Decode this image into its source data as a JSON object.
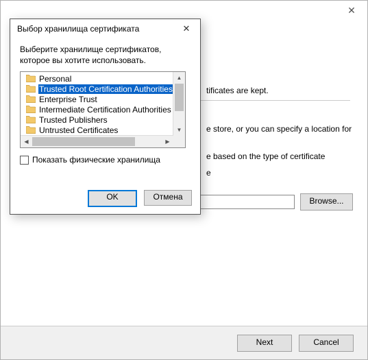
{
  "main": {
    "close_glyph": "✕",
    "frag1": "tificates are kept.",
    "frag2": "e store, or you can specify a location for",
    "frag3": "e based on the type of certificate",
    "frag4": "e",
    "browse_label": "Browse...",
    "next_label": "Next",
    "cancel_label": "Cancel"
  },
  "dialog": {
    "title": "Выбор хранилища сертификата",
    "close_glyph": "✕",
    "instruction": "Выберите хранилище сертификатов, которое вы хотите использовать.",
    "items": [
      "Personal",
      "Trusted Root Certification Authorities",
      "Enterprise Trust",
      "Intermediate Certification Authorities",
      "Trusted Publishers",
      "Untrusted Certificates"
    ],
    "selected_index": 1,
    "show_physical_label": "Показать физические хранилища",
    "ok_label": "OK",
    "cancel_label": "Отмена"
  }
}
